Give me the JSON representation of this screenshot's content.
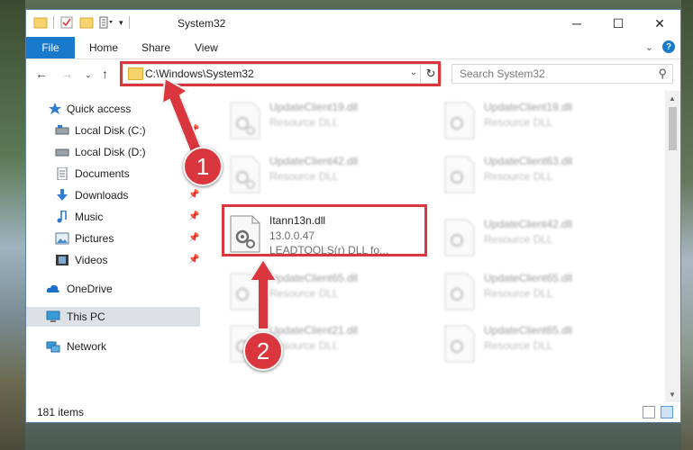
{
  "window": {
    "title": "System32",
    "controls": {
      "minimize": "─",
      "maximize": "☐",
      "close": "✕"
    }
  },
  "ribbon": {
    "tabs": [
      {
        "label": "File"
      },
      {
        "label": "Home"
      },
      {
        "label": "Share"
      },
      {
        "label": "View"
      }
    ],
    "help": "?"
  },
  "navigation": {
    "address": "C:\\Windows\\System32",
    "search_placeholder": "Search System32"
  },
  "sidebar": {
    "items": [
      {
        "label": "Quick access",
        "icon": "star-icon",
        "pinned": false
      },
      {
        "label": "Local Disk (C:)",
        "icon": "drive-icon",
        "pinned": true
      },
      {
        "label": "Local Disk (D:)",
        "icon": "drive-icon",
        "pinned": false
      },
      {
        "label": "Documents",
        "icon": "documents-icon",
        "pinned": true
      },
      {
        "label": "Downloads",
        "icon": "download-icon",
        "pinned": true
      },
      {
        "label": "Music",
        "icon": "music-icon",
        "pinned": true
      },
      {
        "label": "Pictures",
        "icon": "pictures-icon",
        "pinned": true
      },
      {
        "label": "Videos",
        "icon": "videos-icon",
        "pinned": true
      },
      {
        "label": "OneDrive",
        "icon": "cloud-icon",
        "pinned": false
      },
      {
        "label": "This PC",
        "icon": "computer-icon",
        "pinned": false,
        "selected": true
      },
      {
        "label": "Network",
        "icon": "network-icon",
        "pinned": false
      }
    ]
  },
  "files": {
    "left_column": [
      {
        "name": "UpdateClient19.dll",
        "type": "Resource DLL"
      },
      {
        "name": "UpdateClient42.dll",
        "type": "Resource DLL"
      },
      {
        "name": "Itann13n.dll",
        "version": "13.0.0.47",
        "description": "LEADTOOLS(r) DLL fo...",
        "highlighted": true
      },
      {
        "name": "UpdateClient65.dll",
        "type": "Resource DLL"
      },
      {
        "name": "UpdateClient21.dll",
        "type": "Resource DLL"
      }
    ],
    "right_column": [
      {
        "name": "UpdateClient19.dll",
        "type": "Resource DLL"
      },
      {
        "name": "UpdateClient63.dll",
        "type": "Resource DLL"
      },
      {
        "name": "UpdateClient42.dll",
        "type": "Resource DLL"
      },
      {
        "name": "UpdateClient65.dll",
        "type": "Resource DLL"
      },
      {
        "name": "UpdateClient65.dll",
        "type": "Resource DLL"
      }
    ]
  },
  "status": {
    "item_count": "181 items"
  },
  "annotations": {
    "step1": "1",
    "step2": "2",
    "color": "#d9363e"
  }
}
